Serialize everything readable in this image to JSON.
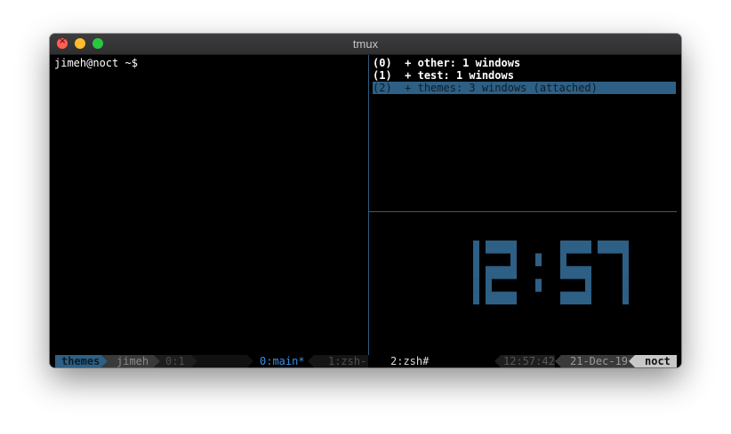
{
  "window": {
    "title": "tmux"
  },
  "left_pane": {
    "prompt": "jimeh@noct ~$"
  },
  "sessions": [
    {
      "index": "(0)",
      "name": "+ other: 1 windows"
    },
    {
      "index": "(1)",
      "name": "+ test: 1 windows"
    },
    {
      "index": "(2)",
      "name": "+ themes: 3 windows (attached)"
    }
  ],
  "clock": {
    "time": "12:57",
    "color": "#2e5f84"
  },
  "status": {
    "session": "themes",
    "user": "jimeh",
    "pane": "0:1",
    "windows": [
      "0:main*",
      "1:zsh-",
      "2:zsh#"
    ],
    "time": "12:57:42",
    "date": "21-Dec-19",
    "host": "noct"
  },
  "colors": {
    "accent": "#2e5f84",
    "divider": "#2f5d80",
    "active_window": "#3a8ee6"
  }
}
